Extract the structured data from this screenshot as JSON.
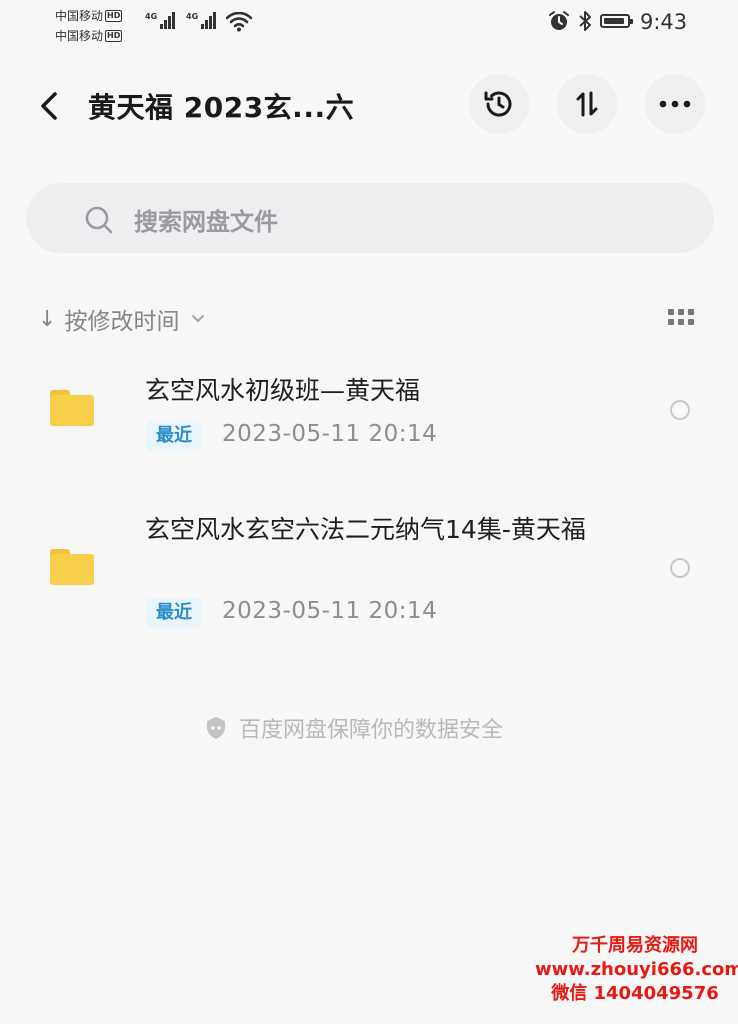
{
  "status_bar": {
    "carrier1": "中国移动",
    "carrier2": "中国移动",
    "hd": "HD",
    "network1": "4G",
    "network2": "4G",
    "time": "9:43"
  },
  "header": {
    "title": "黄天福  2023玄...六"
  },
  "search": {
    "placeholder": "搜索网盘文件"
  },
  "sort": {
    "label": "按修改时间"
  },
  "files": [
    {
      "name": "玄空风水初级班—黄天福",
      "badge": "最近",
      "date": "2023-05-11  20:14"
    },
    {
      "name": "玄空风水玄空六法二元纳气14集-黄天福",
      "badge": "最近",
      "date": "2023-05-11  20:14"
    }
  ],
  "footer": {
    "security_note": "百度网盘保障你的数据安全"
  },
  "watermark": {
    "line1": "万千周易资源网",
    "line2": "www.zhouyi666.com",
    "line3": "微信 1404049576"
  }
}
